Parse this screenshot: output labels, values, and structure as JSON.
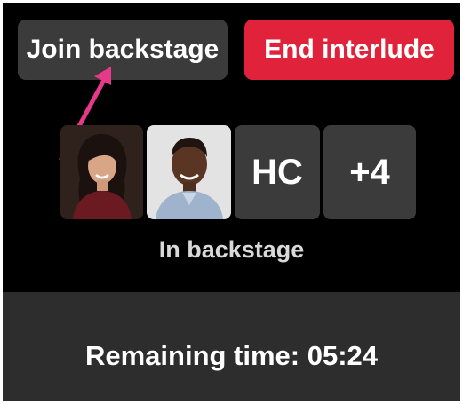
{
  "header": {
    "join_backstage_label": "Join backstage",
    "end_interlude_label": "End interlude"
  },
  "participants": {
    "tiles": [
      {
        "type": "photo",
        "description_icon": "woman-avatar"
      },
      {
        "type": "photo",
        "description_icon": "man-avatar"
      },
      {
        "type": "initials",
        "label": "HC"
      },
      {
        "type": "overflow",
        "label": "+4"
      }
    ],
    "caption": "In backstage"
  },
  "footer": {
    "remaining_time": "Remaining time: 05:24"
  },
  "colors": {
    "background": "#000000",
    "button_secondary": "#3b3b3b",
    "button_danger": "#e0233a",
    "annotation_arrow": "#e6398a",
    "footer": "#2d2d2d"
  }
}
